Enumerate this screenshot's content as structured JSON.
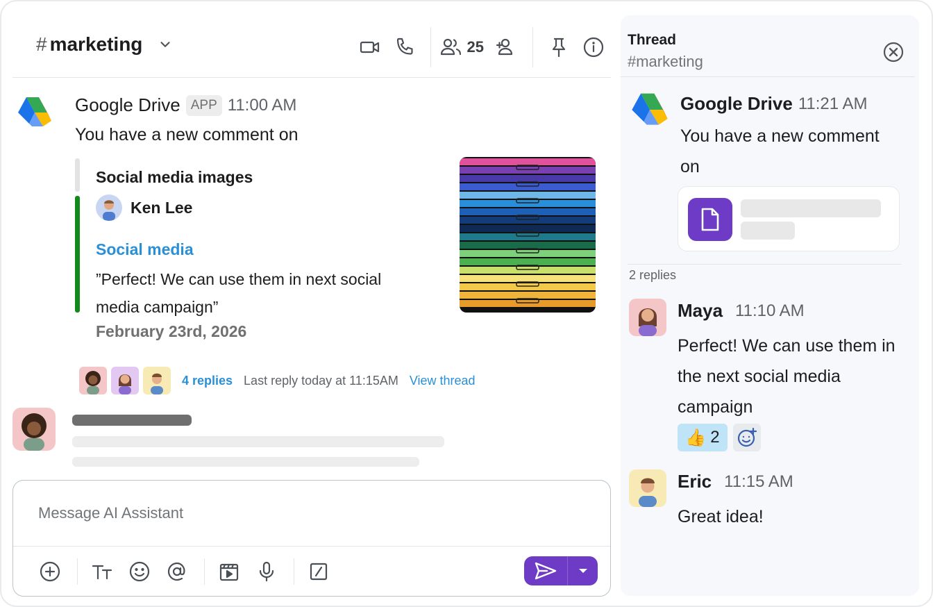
{
  "header": {
    "hash": "#",
    "channel_name": "marketing",
    "member_count": "25"
  },
  "message": {
    "author": "Google Drive",
    "badge": "APP",
    "time": "11:00 AM",
    "body": "You have a new comment on",
    "card": {
      "title": "Social media images",
      "user": "Ken Lee",
      "link": "Social media",
      "quote": "”Perfect! We can use them in next social media campaign”",
      "date": "February 23rd, 2026"
    },
    "replies": {
      "count_label": "4 replies",
      "last_reply": "Last reply today at 11:15AM",
      "view_thread": "View thread"
    }
  },
  "composer": {
    "placeholder": "Message AI Assistant"
  },
  "thread": {
    "title": "Thread",
    "channel": "#marketing",
    "parent": {
      "author": "Google Drive",
      "time": "11:21 AM",
      "body": "You have a new comment on"
    },
    "replies_label": "2 replies",
    "replies": [
      {
        "author": "Maya",
        "time": "11:10 AM",
        "body": "Perfect! We can use them in the next social media campaign",
        "reaction_emoji": "👍",
        "reaction_count": "2"
      },
      {
        "author": "Eric",
        "time": "11:15 AM",
        "body": "Great idea!"
      }
    ]
  },
  "colors": {
    "accent_purple": "#6d3bc5",
    "link_blue": "#2b8fd6",
    "quote_bar_green": "#128a1a",
    "reaction_bg": "#bfe3f7"
  },
  "icons": [
    "video-icon",
    "phone-icon",
    "members-icon",
    "add-member-icon",
    "pin-icon",
    "info-icon",
    "chevron-down-icon",
    "close-icon",
    "plus-icon",
    "text-format-icon",
    "emoji-icon",
    "mention-icon",
    "media-icon",
    "microphone-icon",
    "slash-command-icon",
    "send-icon",
    "caret-down-icon",
    "document-icon",
    "add-reaction-icon"
  ]
}
